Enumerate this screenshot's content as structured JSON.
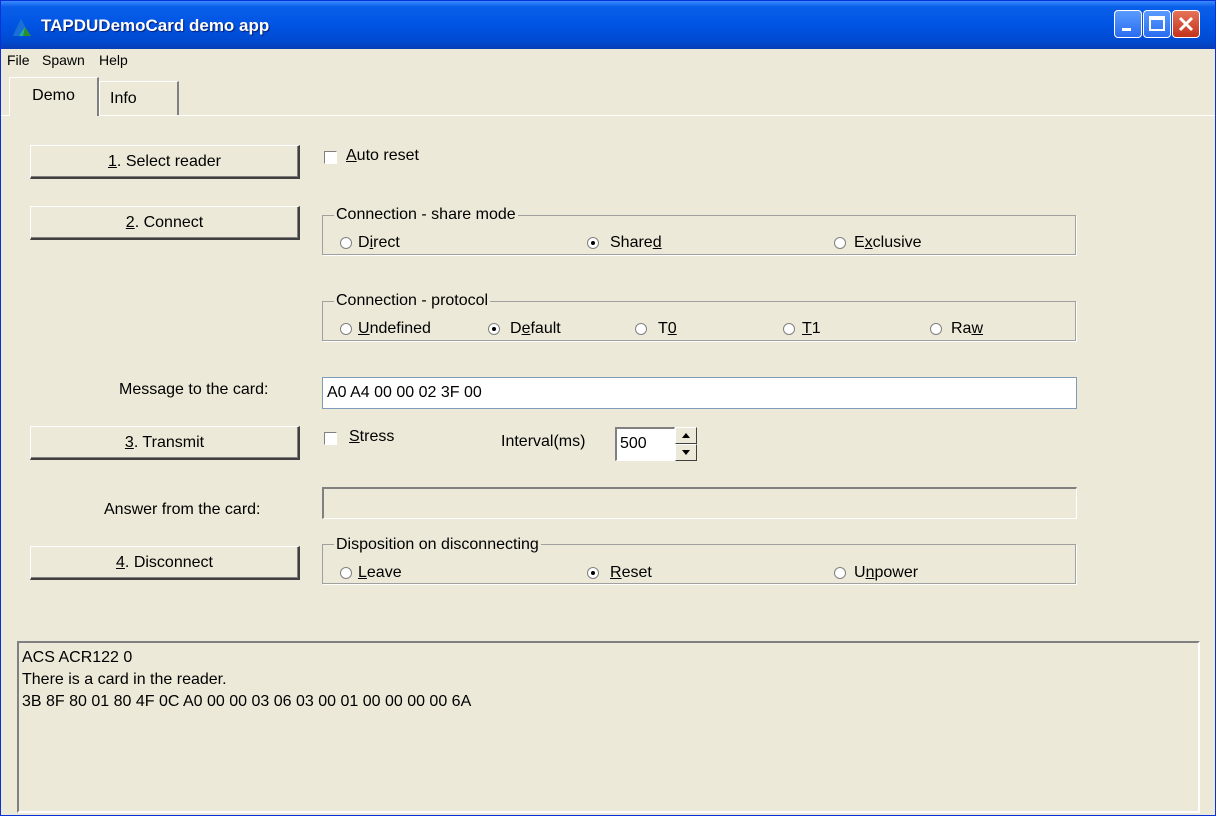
{
  "window": {
    "title": "TAPDUDemoCard demo app"
  },
  "menu": [
    "File",
    "Spawn",
    "Help"
  ],
  "tabs": [
    {
      "label": "Demo"
    },
    {
      "label": "Info"
    }
  ],
  "buttons": {
    "select_reader": "1. Select reader",
    "connect": "2. Connect",
    "transmit": "3. Transmit",
    "disconnect": "4. Disconnect"
  },
  "auto_reset": {
    "label": "Auto reset",
    "checked": false
  },
  "share_mode": {
    "title": "Connection - share mode",
    "options": [
      "Direct",
      "Shared",
      "Exclusive"
    ],
    "selected": "Shared"
  },
  "protocol": {
    "title": "Connection - protocol",
    "options": [
      "Undefined",
      "Default",
      "T0",
      "T1",
      "Raw"
    ],
    "selected": "Default"
  },
  "message": {
    "label": "Message to the card:",
    "value": "A0 A4 00 00 02 3F 00"
  },
  "stress": {
    "label": "Stress",
    "checked": false
  },
  "interval": {
    "label": "Interval(ms)",
    "value": "500"
  },
  "answer": {
    "label": "Answer from the card:",
    "value": ""
  },
  "disposition": {
    "title": "Disposition on disconnecting",
    "options": [
      "Leave",
      "Reset",
      "Unpower"
    ],
    "selected": "Reset"
  },
  "log": {
    "lines": [
      "ACS ACR122 0",
      "There is a card in the reader.",
      "3B 8F 80 01 80 4F 0C A0 00 00 03 06 03 00 01 00 00 00 00 6A"
    ]
  },
  "colors": {
    "title_bar": "#0054e3",
    "window_bg": "#ece9d8",
    "close_button": "#c4321a"
  }
}
